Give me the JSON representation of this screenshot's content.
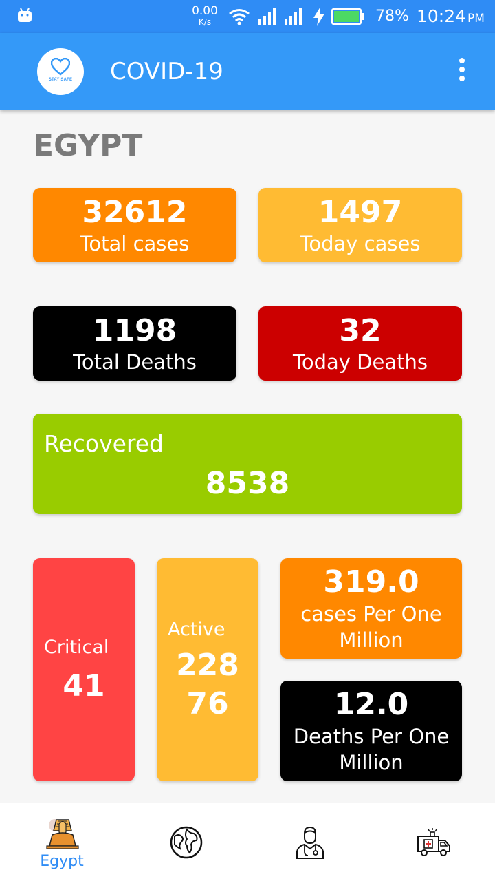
{
  "status_bar": {
    "net_speed_value": "0.00",
    "net_speed_unit": "K/s",
    "battery_percent": "78%",
    "time": "10:24",
    "time_suffix": "PM"
  },
  "app_bar": {
    "logo_text": "STAY SAFE",
    "title": "COVID-19",
    "menu_icon": "more-vertical-icon"
  },
  "country": "EGYPT",
  "stats": {
    "total_cases": {
      "value": "32612",
      "label": "Total cases"
    },
    "today_cases": {
      "value": "1497",
      "label": "Today cases"
    },
    "total_deaths": {
      "value": "1198",
      "label": "Total Deaths"
    },
    "today_deaths": {
      "value": "32",
      "label": "Today Deaths"
    },
    "recovered": {
      "value": "8538",
      "label": "Recovered"
    },
    "critical": {
      "value": "41",
      "label": "Critical"
    },
    "active": {
      "value": "22876",
      "label": "Active"
    },
    "cases_per_million": {
      "value": "319.0",
      "label": "cases Per One Million"
    },
    "deaths_per_million": {
      "value": "12.0",
      "label": "Deaths Per One Million"
    }
  },
  "colors": {
    "primary": "#3499f8",
    "orange": "#ff8800",
    "amber": "#ffbb33",
    "black": "#000000",
    "dark_red": "#cc0000",
    "green": "#99cc00",
    "red": "#ff4444"
  },
  "bottom_nav": {
    "items": [
      {
        "icon": "sphinx-icon",
        "label": "Egypt",
        "selected": true
      },
      {
        "icon": "globe-icon",
        "label": ""
      },
      {
        "icon": "doctor-icon",
        "label": ""
      },
      {
        "icon": "ambulance-icon",
        "label": ""
      }
    ]
  }
}
